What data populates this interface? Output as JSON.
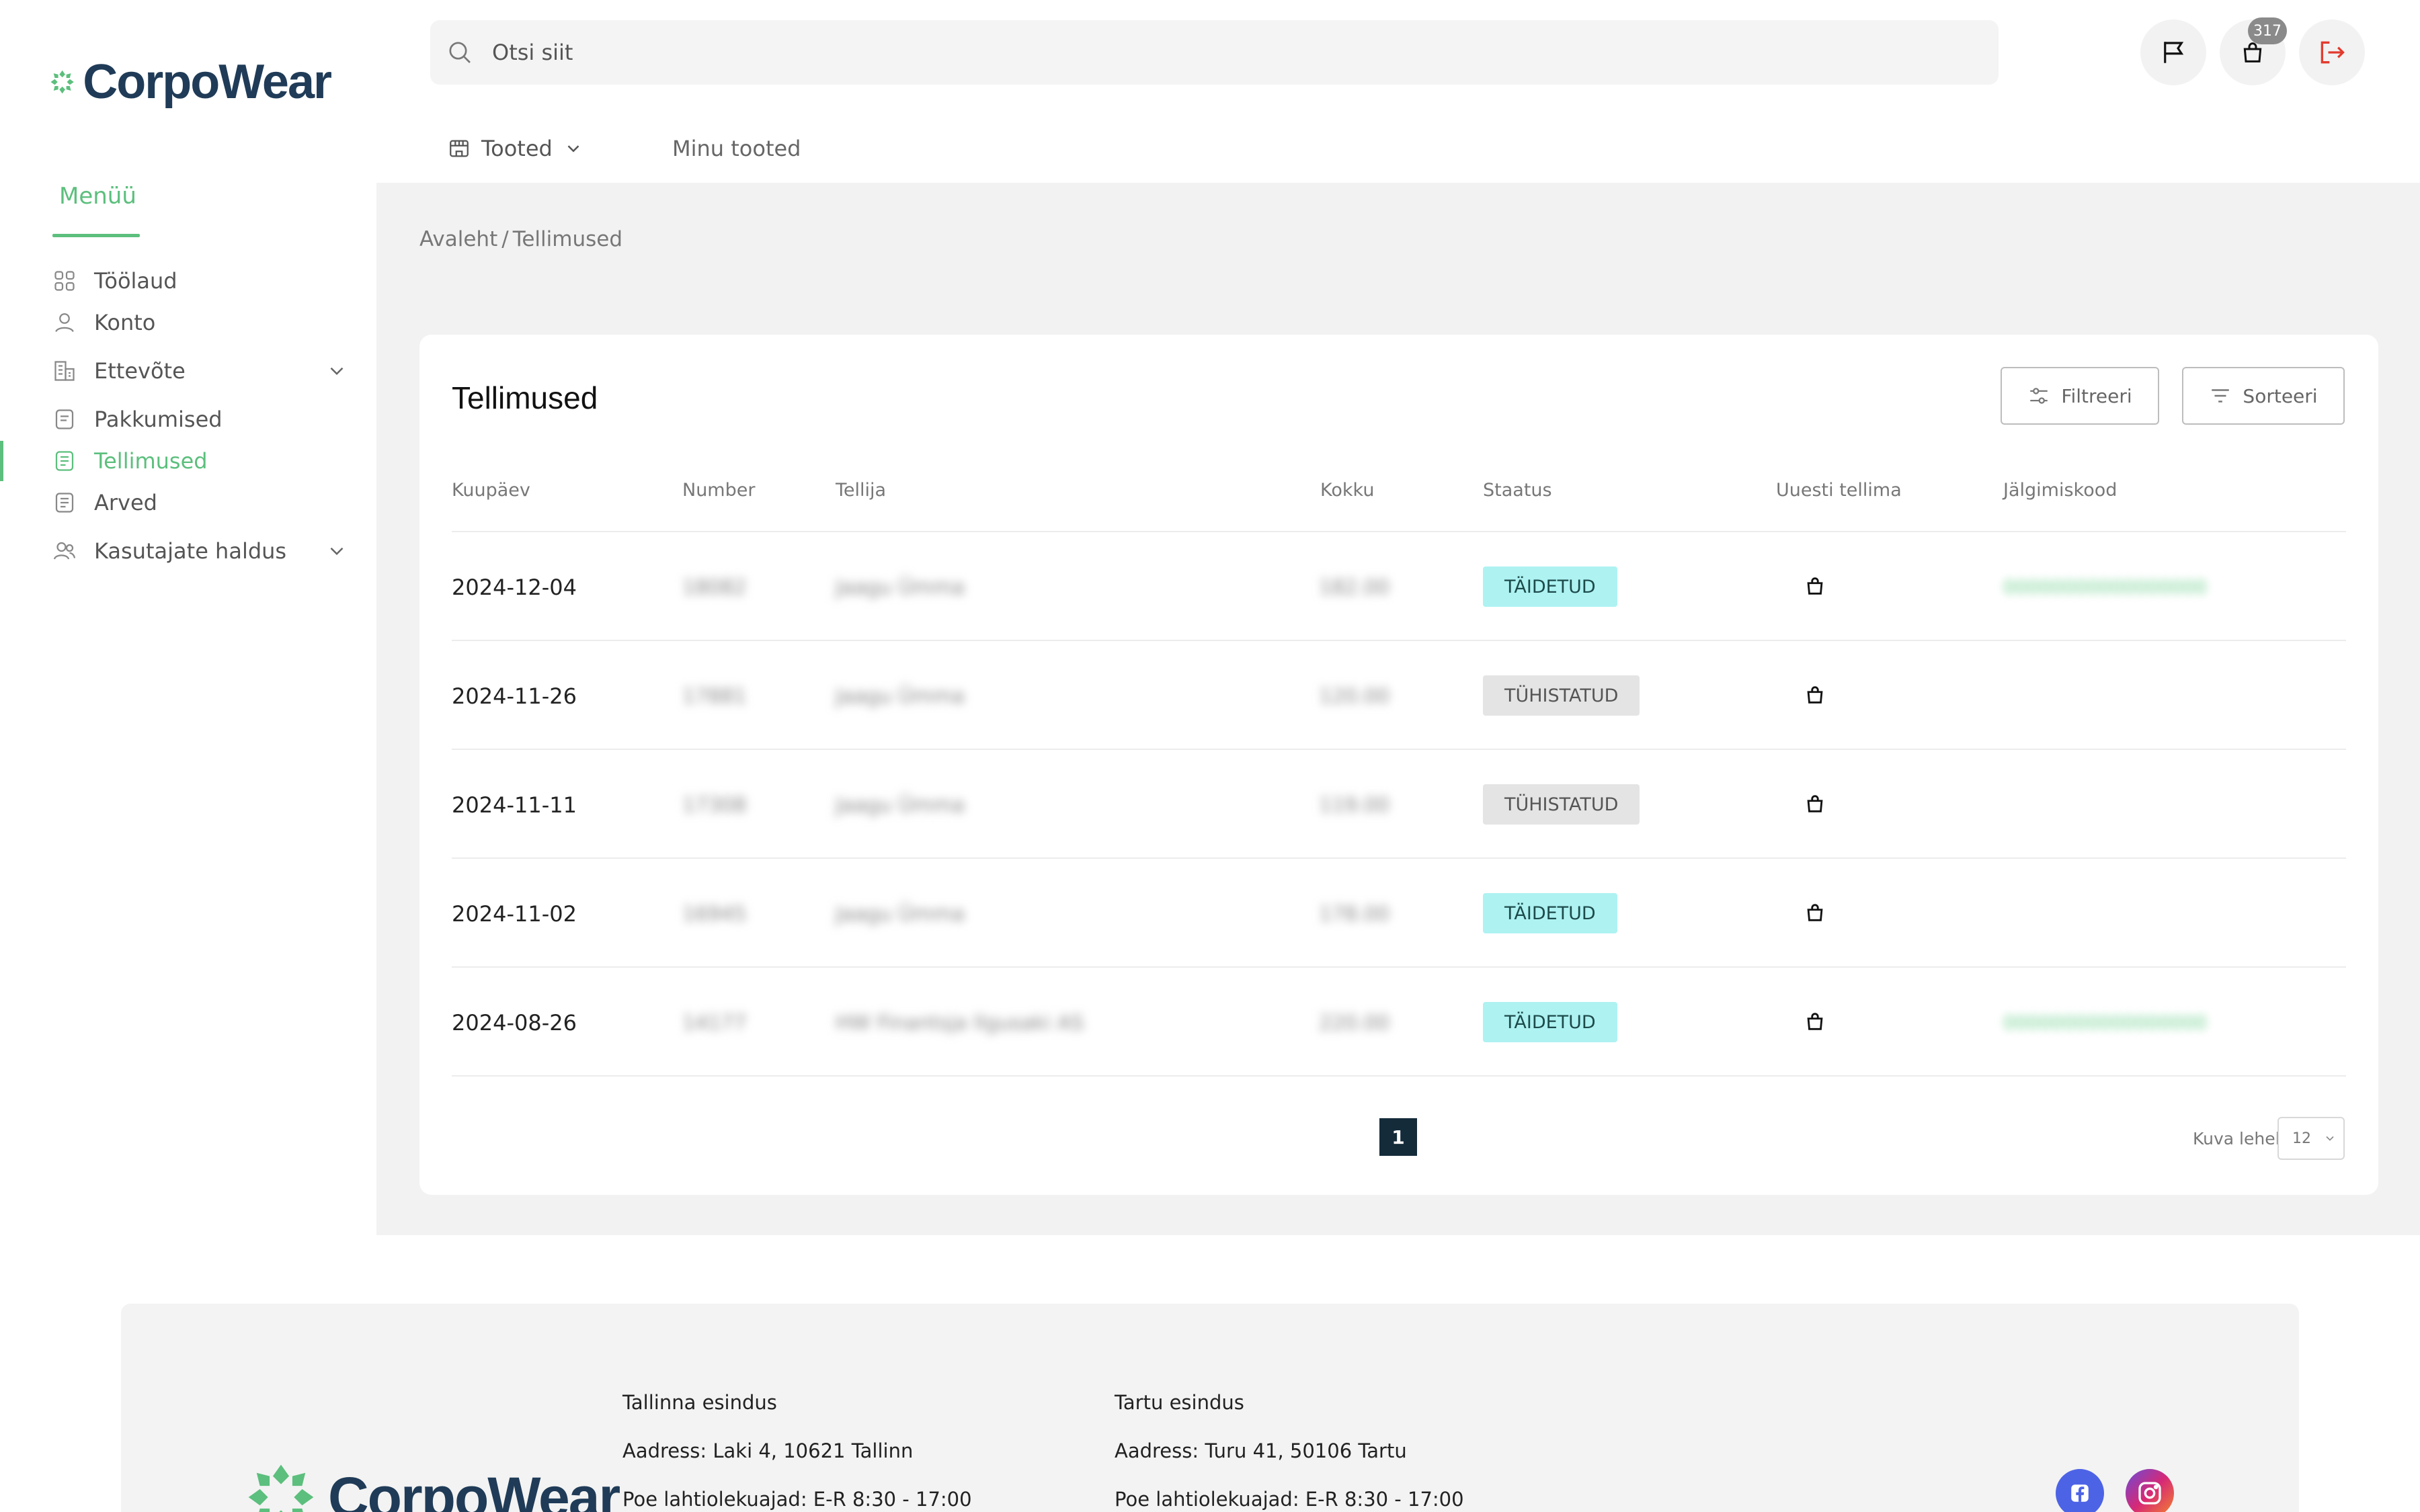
{
  "header": {
    "logo_text": "CorpoWear",
    "search_placeholder": "Otsi siit",
    "cart_count": "317",
    "nav": {
      "products": "Tooted",
      "my_products": "Minu tooted"
    }
  },
  "sidebar": {
    "title": "Menüü",
    "items": [
      {
        "label": "Töölaud",
        "icon": "dashboard-icon"
      },
      {
        "label": "Konto",
        "icon": "user-icon"
      },
      {
        "label": "Ettevõte",
        "icon": "company-icon",
        "expandable": true
      },
      {
        "label": "Pakkumised",
        "icon": "document-icon"
      },
      {
        "label": "Tellimused",
        "icon": "document-icon",
        "active": true
      },
      {
        "label": "Arved",
        "icon": "document-icon"
      },
      {
        "label": "Kasutajate haldus",
        "icon": "users-icon",
        "expandable": true
      }
    ]
  },
  "breadcrumb": {
    "home": "Avaleht",
    "sep": "/",
    "current": "Tellimused"
  },
  "orders": {
    "title": "Tellimused",
    "filter_label": "Filtreeri",
    "sort_label": "Sorteeri",
    "columns": [
      "Kuupäev",
      "Number",
      "Tellija",
      "Kokku",
      "Staatus",
      "Uuesti tellima",
      "Jälgimiskood"
    ],
    "rows": [
      {
        "date": "2024-12-04",
        "number": "18082",
        "customer": "Jaagu Ümma",
        "total": "182.00",
        "status": "TÄIDETUD",
        "status_type": "done",
        "tracking": "00000000000000000"
      },
      {
        "date": "2024-11-26",
        "number": "17881",
        "customer": "Jaagu Ümma",
        "total": "120.00",
        "status": "TÜHISTATUD",
        "status_type": "cancel",
        "tracking": ""
      },
      {
        "date": "2024-11-11",
        "number": "17308",
        "customer": "Jaagu Ümma",
        "total": "119.00",
        "status": "TÜHISTATUD",
        "status_type": "cancel",
        "tracking": ""
      },
      {
        "date": "2024-11-02",
        "number": "16945",
        "customer": "Jaagu Ümma",
        "total": "178.00",
        "status": "TÄIDETUD",
        "status_type": "done",
        "tracking": ""
      },
      {
        "date": "2024-08-26",
        "number": "14177",
        "customer": "HW Finantsja Ilgusaki AS",
        "total": "220.00",
        "status": "TÄIDETUD",
        "status_type": "done",
        "tracking": "00000000000000000"
      }
    ],
    "current_page": "1",
    "per_page_label": "Kuva lehel",
    "per_page_value": "12"
  },
  "footer": {
    "logo_text": "CorpoWear",
    "tallinn": {
      "title": "Tallinna esindus",
      "address": "Aadress: Laki 4, 10621 Tallinn",
      "hours": "Poe lahtiolekuajad: E-R 8:30 - 17:00"
    },
    "tartu": {
      "title": "Tartu esindus",
      "address": "Aadress: Turu 41, 50106 Tartu",
      "hours": "Poe lahtiolekuajad: E-R 8:30 - 17:00"
    }
  },
  "colors": {
    "accent": "#5cbf7d",
    "brand": "#1f3b57",
    "done_badge": "#aef2f2",
    "cancel_badge": "#e4e4e4",
    "logout": "#e23b2e"
  }
}
